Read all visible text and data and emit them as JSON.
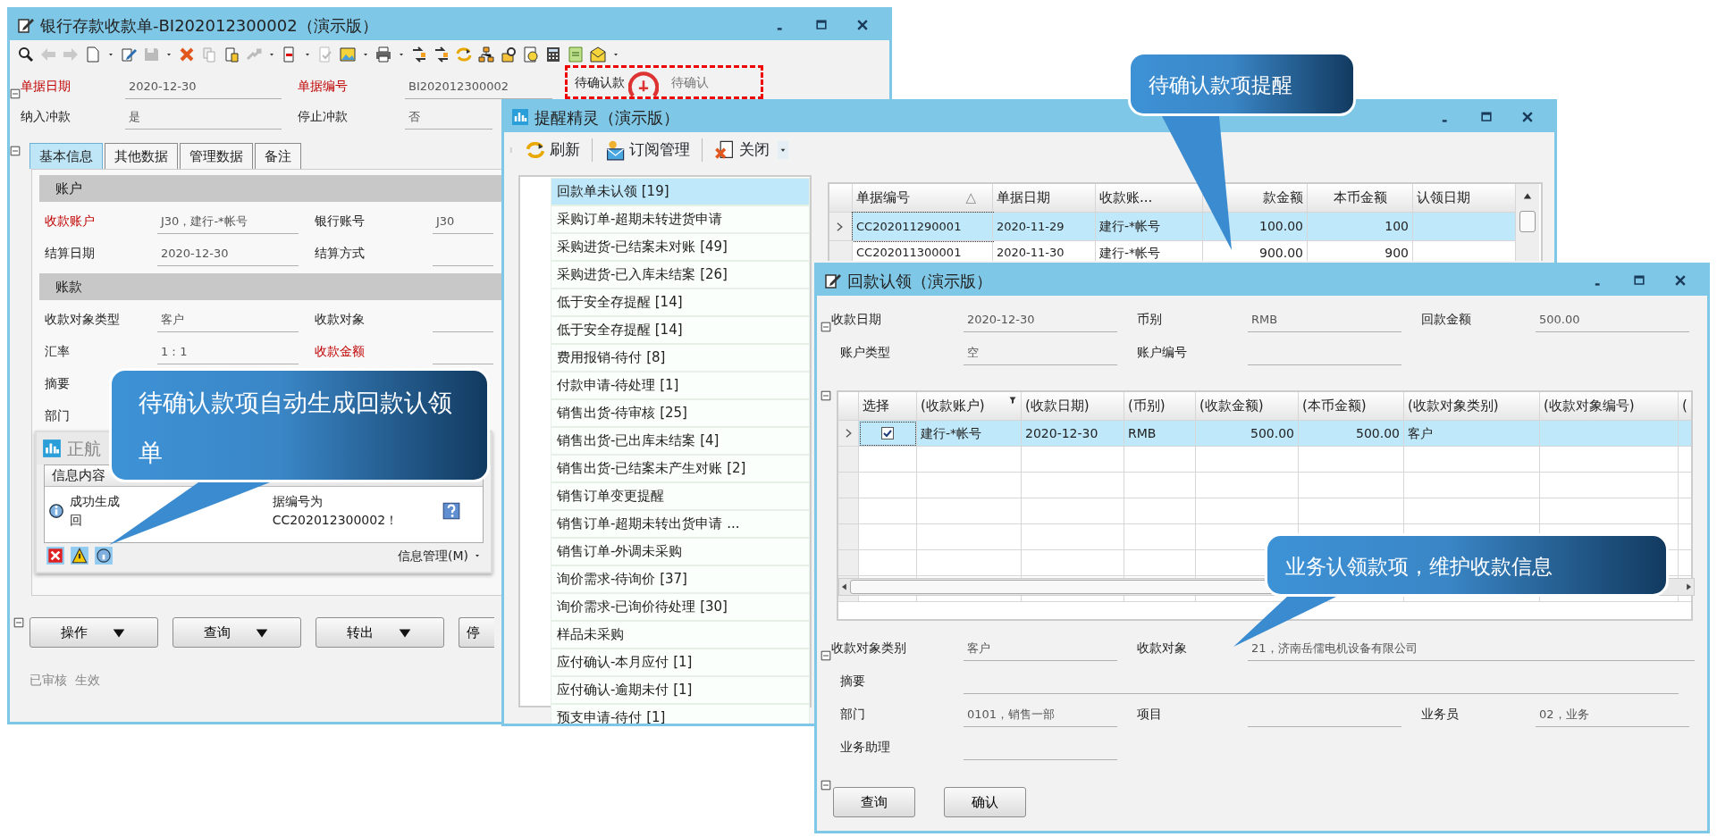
{
  "receipt_window": {
    "title": "银行存款收款单-BI202012300002（演示版）",
    "header_rows": [
      [
        {
          "label": "单据日期",
          "value": "2020-12-30",
          "required": true
        },
        {
          "label": "单据编号",
          "value": "BI202012300002",
          "required": true
        }
      ],
      [
        {
          "label": "纳入冲款",
          "value": "是",
          "required": false
        },
        {
          "label": "停止冲款",
          "value": "否",
          "required": false
        }
      ]
    ],
    "status_box": {
      "label": "待确认款",
      "value": "待确认"
    },
    "tabs": [
      {
        "label": "基本信息",
        "selected": true
      },
      {
        "label": "其他数据",
        "selected": false
      },
      {
        "label": "管理数据",
        "selected": false
      },
      {
        "label": "备注",
        "selected": false
      }
    ],
    "groups": [
      {
        "title": "账户",
        "rows": [
          [
            {
              "label": "收款账户",
              "value": "J30，建行-*帐号",
              "required": true
            },
            {
              "label": "银行账号",
              "value": "J30",
              "required": false
            }
          ],
          [
            {
              "label": "结算日期",
              "value": "2020-12-30",
              "required": false
            },
            {
              "label": "结算方式",
              "required": false
            }
          ]
        ]
      },
      {
        "title": "账款",
        "rows": [
          [
            {
              "label": "收款对象类型",
              "value": "客户",
              "required": false
            },
            {
              "label": "收款对象",
              "required": false
            }
          ],
          [
            {
              "label": "汇率",
              "value": "1：1",
              "required": false
            },
            {
              "label": "收款金额",
              "required": true
            }
          ],
          [
            {
              "label": "摘要",
              "required": false
            }
          ],
          [
            {
              "label": "部门",
              "required": false
            }
          ]
        ]
      }
    ],
    "message_window": {
      "title": "正航",
      "column": "信息内容",
      "message_parts": [
        "成功生成回",
        "据编号为CC202012300002！"
      ],
      "menu": "信息管理(M)"
    },
    "buttons": [
      {
        "label": "操作",
        "dropdown": true
      },
      {
        "label": "查询",
        "dropdown": true
      },
      {
        "label": "转出",
        "dropdown": true
      },
      {
        "label": "停",
        "dropdown": false
      }
    ],
    "status": "已审核  生效"
  },
  "reminder_window": {
    "title": "提醒精灵（演示版）",
    "toolbar": [
      {
        "label": "刷新"
      },
      {
        "label": "订阅管理"
      },
      {
        "label": "关闭"
      }
    ],
    "items": [
      {
        "label": "回款单未认领 [19]",
        "selected": true
      },
      {
        "label": "采购订单-超期未转进货申请",
        "selected": false
      },
      {
        "label": "采购进货-已结案未对账 [49]",
        "selected": false
      },
      {
        "label": "采购进货-已入库未结案 [26]",
        "selected": false
      },
      {
        "label": "低于安全存提醒 [14]",
        "selected": false
      },
      {
        "label": "低于安全存提醒 [14]",
        "selected": false
      },
      {
        "label": "费用报销-待付 [8]",
        "selected": false
      },
      {
        "label": "付款申请-待处理 [1]",
        "selected": false
      },
      {
        "label": "销售出货-待审核 [25]",
        "selected": false
      },
      {
        "label": "销售出货-已出库未结案 [4]",
        "selected": false
      },
      {
        "label": "销售出货-已结案未产生对账 [2]",
        "selected": false
      },
      {
        "label": "销售订单变更提醒",
        "selected": false
      },
      {
        "label": "销售订单-超期未转出货申请 ...",
        "selected": false
      },
      {
        "label": "销售订单-外调未采购",
        "selected": false
      },
      {
        "label": "询价需求-待询价 [37]",
        "selected": false
      },
      {
        "label": "询价需求-已询价待处理 [30]",
        "selected": false
      },
      {
        "label": "样品未采购",
        "selected": false
      },
      {
        "label": "应付确认-本月应付 [1]",
        "selected": false
      },
      {
        "label": "应付确认-逾期未付 [1]",
        "selected": false
      },
      {
        "label": "预支申请-待付 [1]",
        "selected": false
      }
    ],
    "table": {
      "columns": [
        {
          "label": "单据编号",
          "sort": "△"
        },
        {
          "label": "单据日期"
        },
        {
          "label": "收款账..."
        },
        {
          "label": "款金额"
        },
        {
          "label": "本币金额"
        },
        {
          "label": "认领日期"
        }
      ],
      "rows": [
        {
          "cells": [
            "CC202011290001",
            "2020-11-29",
            "建行-*帐号",
            "100.00",
            "100",
            ""
          ],
          "selected": true
        },
        {
          "cells": [
            "CC202011300001",
            "2020-11-30",
            "建行-*帐号",
            "900.00",
            "900",
            ""
          ],
          "selected": false
        }
      ]
    }
  },
  "claim_window": {
    "title": "回款认领（演示版）",
    "top_rows": [
      [
        {
          "label": "收款日期",
          "value": "2020-12-30"
        },
        {
          "label": "币别",
          "value": "RMB"
        },
        {
          "label": "回款金额",
          "value": "500.00"
        }
      ],
      [
        {
          "label": "账户类型",
          "value": "空"
        },
        {
          "label": "账户编号"
        }
      ]
    ],
    "table": {
      "columns": [
        "选择",
        "(收款账户)",
        "(收款日期)",
        "(币别)",
        "(收款金额)",
        "(本币金额)",
        "(收款对象类别)",
        "(收款对象编号)",
        "("
      ],
      "rows": [
        {
          "checked": true,
          "cells": [
            "",
            "建行-*帐号",
            "2020-12-30",
            "RMB",
            "500.00",
            "500.00",
            "客户",
            "",
            ""
          ],
          "selected": true
        }
      ]
    },
    "bottom_rows": [
      [
        {
          "label": "收款对象类别",
          "value": "客户"
        },
        {
          "label": "收款对象",
          "value": "21，济南岳儒电机设备有限公司"
        }
      ],
      [
        {
          "label": "部门",
          "value": "0101，销售一部"
        },
        {
          "label": "项目"
        },
        {
          "label": "业务员",
          "value": "02，业务"
        }
      ],
      [
        {
          "label": "业务助理"
        }
      ]
    ],
    "summary": {
      "label": "摘要"
    },
    "buttons": [
      "查询",
      "确认"
    ]
  },
  "callouts": [
    {
      "text": "待确认款项自动生成回款认领单"
    },
    {
      "text": "待确认款项提醒"
    },
    {
      "text": "业务认领款项，维护收款信息"
    }
  ]
}
